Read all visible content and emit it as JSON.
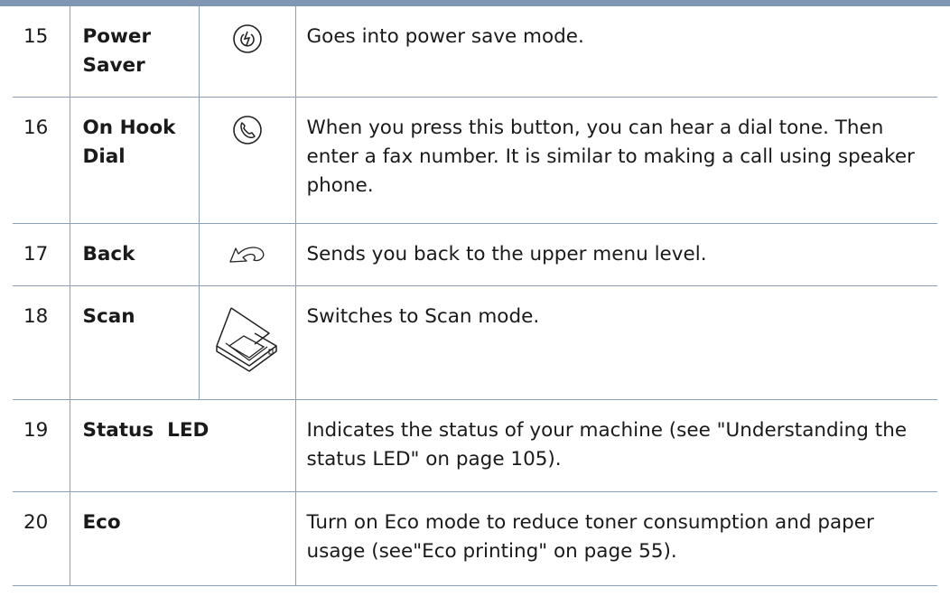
{
  "rows": [
    {
      "num": "15",
      "name": "Power Saver",
      "icon": "power-save-icon",
      "desc": "Goes into power save mode."
    },
    {
      "num": "16",
      "name": "On Hook Dial",
      "icon": "phone-handset-icon",
      "desc": "When you press this button, you can hear a dial tone. Then enter a fax number. It is similar to making a call using speaker phone."
    },
    {
      "num": "17",
      "name": "Back",
      "icon": "back-arrow-icon",
      "desc": "Sends you back to the upper menu level."
    },
    {
      "num": "18",
      "name": "Scan",
      "icon": "scanner-icon",
      "desc": "Switches to Scan mode."
    },
    {
      "num": "19",
      "name": "Status  LED",
      "icon": "",
      "desc": "Indicates the status of your machine (see \"Understanding the status LED\" on page 105)."
    },
    {
      "num": "20",
      "name": "Eco",
      "icon": "",
      "desc": "Turn on Eco mode to reduce toner consumption and paper usage (see\"Eco printing\" on page 55)."
    }
  ],
  "colors": {
    "rule": "#8aa0b8",
    "topbar": "#7f97b3",
    "text": "#1a1a1a"
  }
}
